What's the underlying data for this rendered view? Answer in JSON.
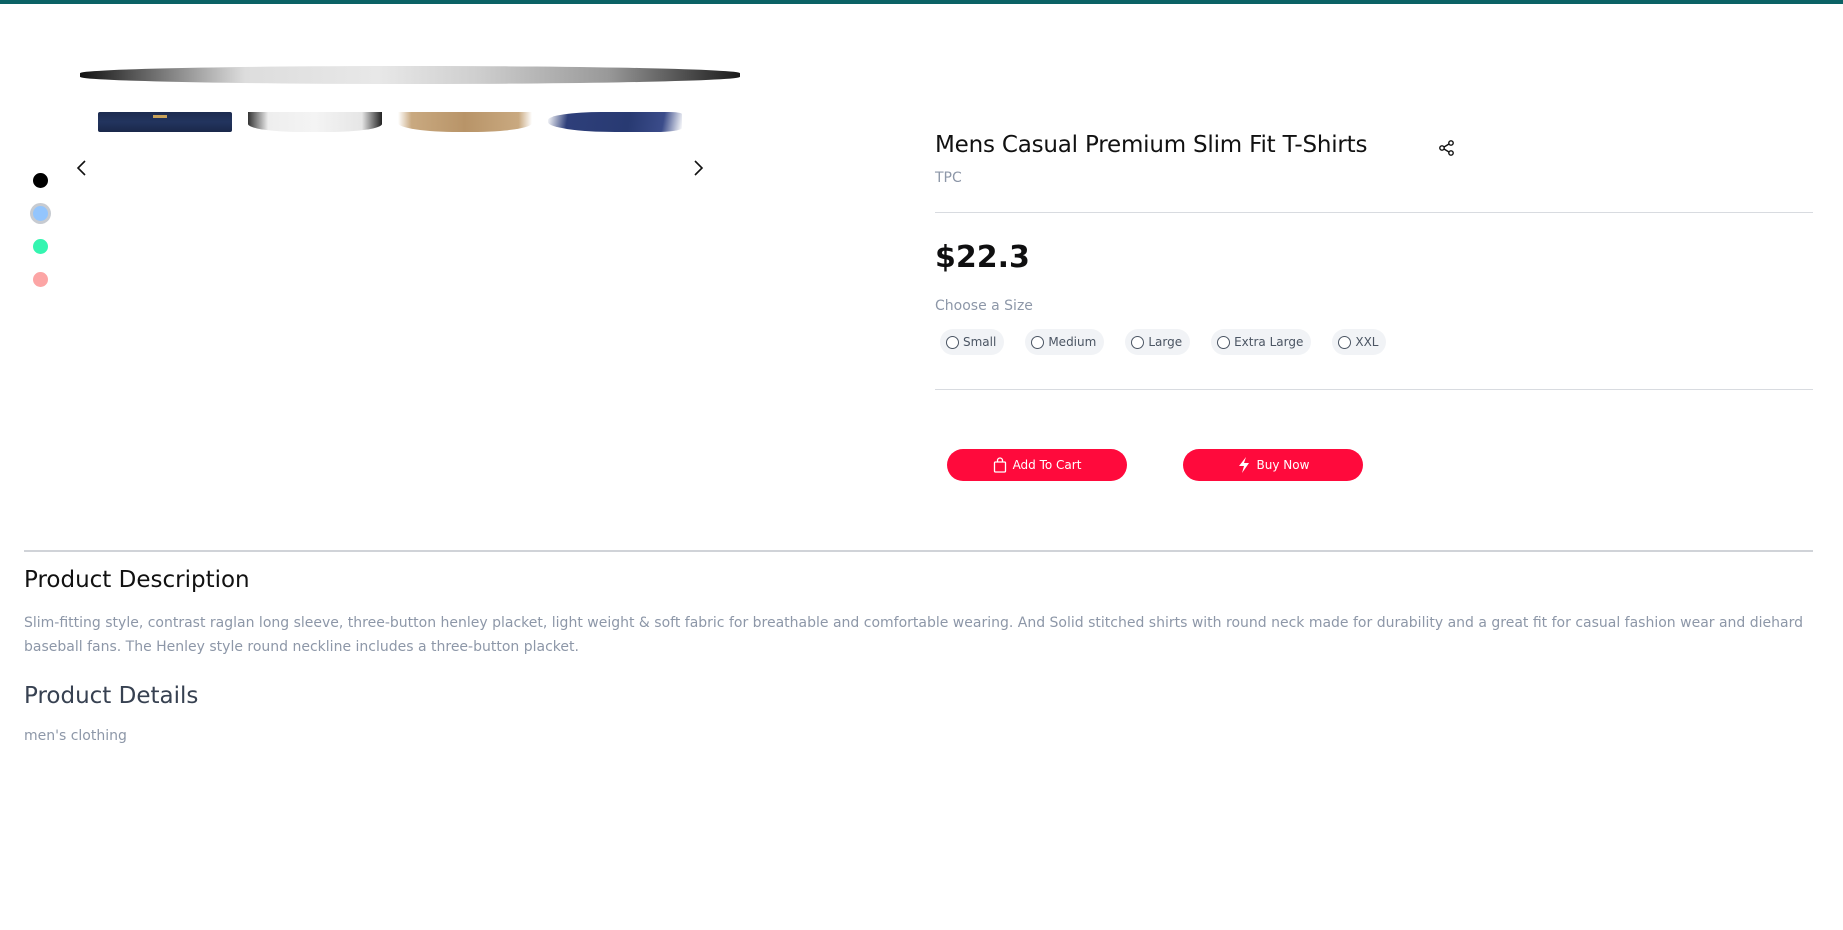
{
  "gallery": {
    "thumbnails": [
      "thumbnail-navy",
      "thumbnail-white",
      "thumbnail-khaki",
      "thumbnail-blue"
    ],
    "prev_icon": "chevron-left-icon",
    "next_icon": "chevron-right-icon"
  },
  "colors": {
    "swatches": [
      "#000000",
      "#93c5fd",
      "#34f5b0",
      "#fca5a5"
    ],
    "selected": "#93c5fd",
    "accent": "#ff0a3c",
    "topbar": "#0b6265"
  },
  "product": {
    "title": "Mens Casual Premium Slim Fit T-Shirts",
    "brand": "TPC",
    "price": "$22.3",
    "size_label": "Choose a Size",
    "sizes": [
      "Small",
      "Medium",
      "Large",
      "Extra Large",
      "XXL"
    ],
    "share_icon": "share-icon"
  },
  "actions": {
    "add_to_cart": "Add To Cart",
    "buy_now": "Buy Now"
  },
  "description": {
    "heading": "Product Description",
    "text": "Slim-fitting style, contrast raglan long sleeve, three-button henley placket, light weight & soft fabric for breathable and comfortable wearing. And Solid stitched shirts with round neck made for durability and a great fit for casual fashion wear and diehard baseball fans. The Henley style round neckline includes a three-button placket."
  },
  "details": {
    "heading": "Product Details",
    "category": "men's clothing"
  }
}
